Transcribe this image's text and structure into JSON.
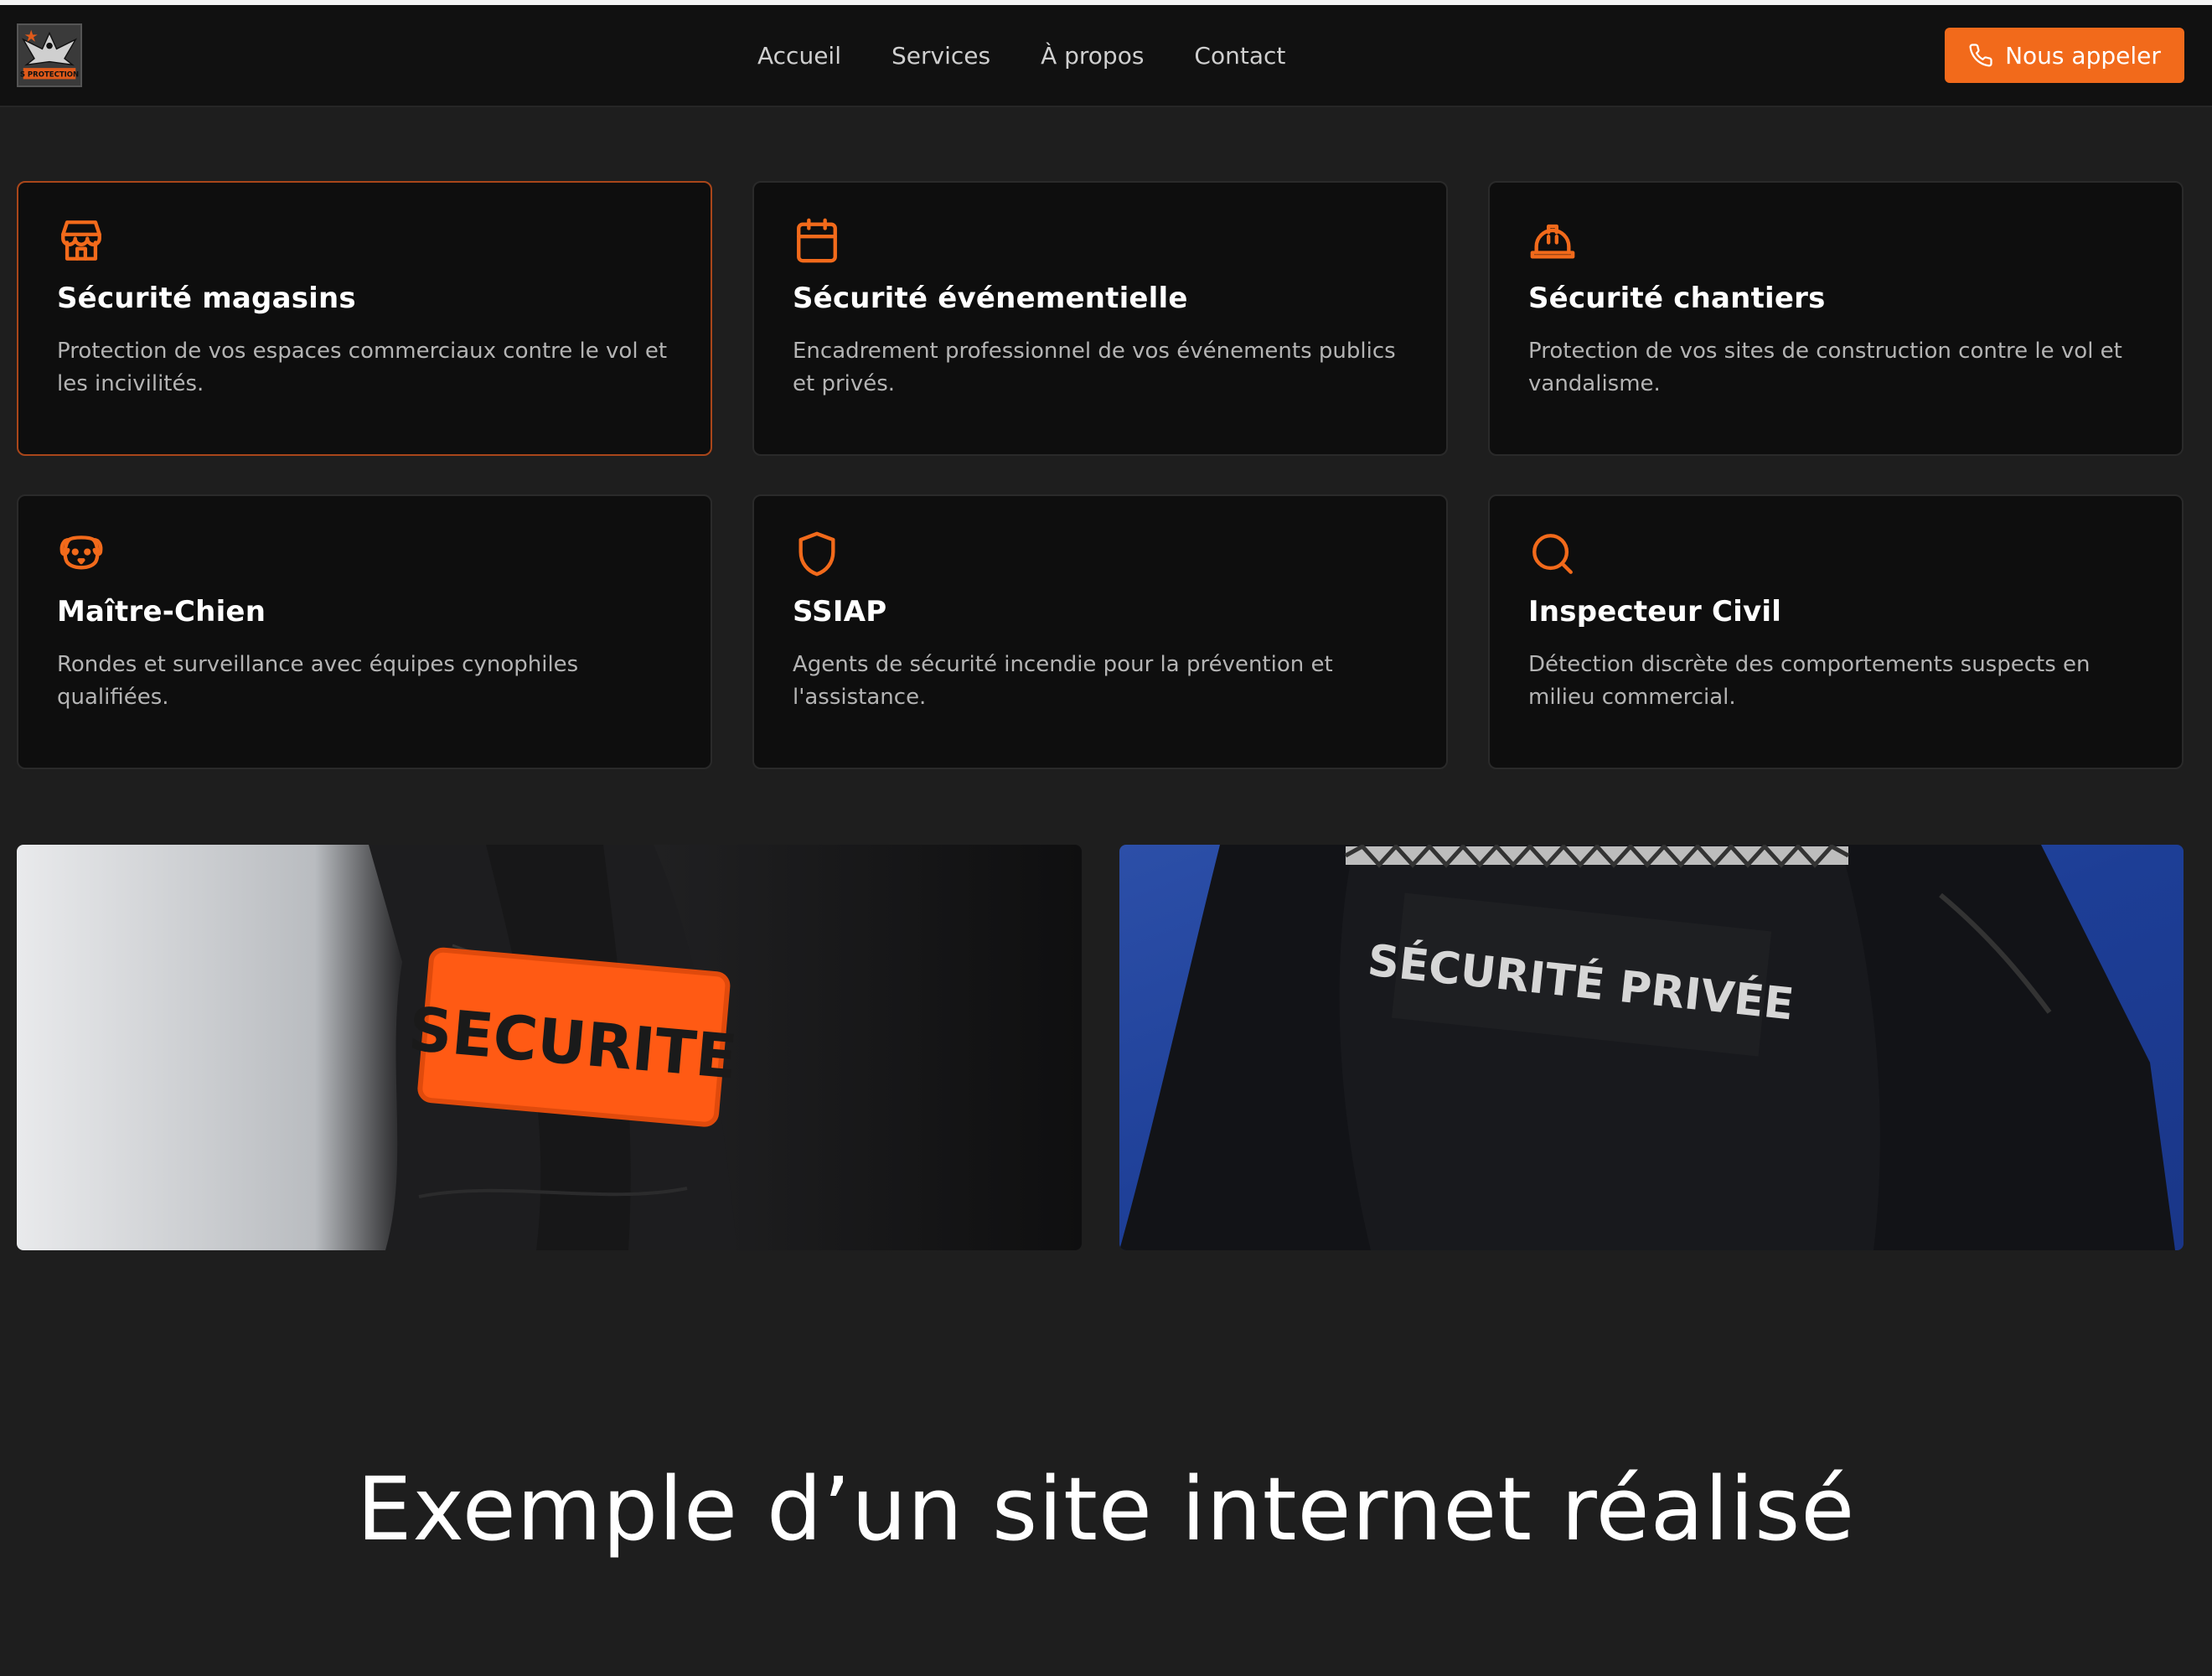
{
  "header": {
    "nav": [
      "Accueil",
      "Services",
      "À propos",
      "Contact"
    ],
    "cta_label": "Nous appeler",
    "logo_text": "S PROTECTION"
  },
  "services": [
    {
      "title": "Sécurité magasins",
      "description": "Protection de vos espaces commerciaux contre le vol et les incivilités.",
      "icon": "store-icon"
    },
    {
      "title": "Sécurité événementielle",
      "description": "Encadrement professionnel de vos événements publics et privés.",
      "icon": "calendar-icon"
    },
    {
      "title": "Sécurité chantiers",
      "description": "Protection de vos sites de construction contre le vol et vandalisme.",
      "icon": "hard-hat-icon"
    },
    {
      "title": "Maître-Chien",
      "description": "Rondes et surveillance avec équipes cynophiles qualifiées.",
      "icon": "dog-icon"
    },
    {
      "title": "SSIAP",
      "description": "Agents de sécurité incendie pour la prévention et l'assistance.",
      "icon": "shield-icon"
    },
    {
      "title": "Inspecteur Civil",
      "description": "Détection discrète des comportements suspects en milieu commercial.",
      "icon": "search-icon"
    }
  ],
  "photos": {
    "left_text": "SECURITE",
    "right_text": "SÉCURITÉ PRIVÉE"
  },
  "caption": "Exemple d’un site internet réalisé",
  "colors": {
    "accent": "#f26a1b",
    "background": "#1e1e1e",
    "card": "#0e0e0e",
    "header": "#111111"
  }
}
